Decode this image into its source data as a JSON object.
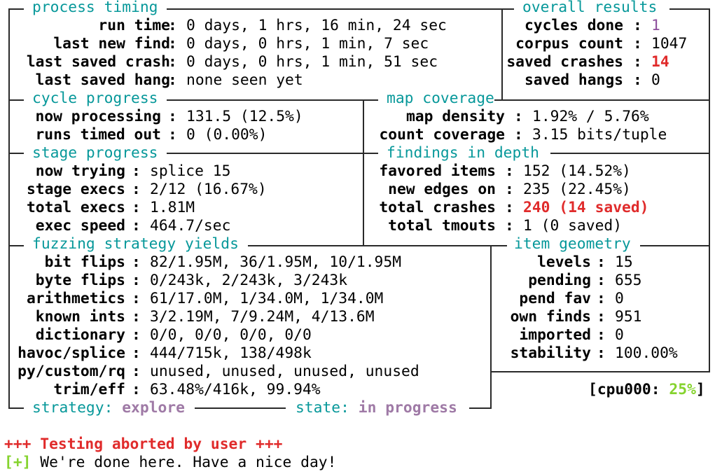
{
  "process_timing": {
    "title": "process timing",
    "run_time_label": "run time",
    "run_time": "0 days, 1 hrs, 16 min, 24 sec",
    "last_new_find_label": "last new find",
    "last_new_find": "0 days, 0 hrs, 1 min, 7 sec",
    "last_saved_crash_label": "last saved crash",
    "last_saved_crash": "0 days, 0 hrs, 1 min, 51 sec",
    "last_saved_hang_label": "last saved hang",
    "last_saved_hang": "none seen yet"
  },
  "overall_results": {
    "title": "overall results",
    "cycles_done_label": "cycles done",
    "cycles_done": "1",
    "corpus_count_label": "corpus count",
    "corpus_count": "1047",
    "saved_crashes_label": "saved crashes",
    "saved_crashes": "14",
    "saved_hangs_label": "saved hangs",
    "saved_hangs": "0"
  },
  "cycle_progress": {
    "title": "cycle progress",
    "now_processing_label": "now processing",
    "now_processing": "131.5 (12.5%)",
    "runs_timed_out_label": "runs timed out",
    "runs_timed_out": "0 (0.00%)"
  },
  "map_coverage": {
    "title": "map coverage",
    "map_density_label": "map density",
    "map_density": "1.92% / 5.76%",
    "count_coverage_label": "count coverage",
    "count_coverage": "3.15 bits/tuple"
  },
  "stage_progress": {
    "title": "stage progress",
    "now_trying_label": "now trying",
    "now_trying": "splice 15",
    "stage_execs_label": "stage execs",
    "stage_execs": "2/12 (16.67%)",
    "total_execs_label": "total execs",
    "total_execs": "1.81M",
    "exec_speed_label": "exec speed",
    "exec_speed": "464.7/sec"
  },
  "findings_in_depth": {
    "title": "findings in depth",
    "favored_items_label": "favored items",
    "favored_items": "152 (14.52%)",
    "new_edges_on_label": "new edges on",
    "new_edges_on": "235 (22.45%)",
    "total_crashes_label": "total crashes",
    "total_crashes": "240 (14 saved)",
    "total_tmouts_label": "total tmouts",
    "total_tmouts": "1 (0 saved)"
  },
  "fuzzing_strategy_yields": {
    "title": "fuzzing strategy yields",
    "bit_flips_label": "bit flips",
    "bit_flips": "82/1.95M, 36/1.95M, 10/1.95M",
    "byte_flips_label": "byte flips",
    "byte_flips": "0/243k, 2/243k, 3/243k",
    "arithmetics_label": "arithmetics",
    "arithmetics": "61/17.0M, 1/34.0M, 1/34.0M",
    "known_ints_label": "known ints",
    "known_ints": "3/2.19M, 7/9.24M, 4/13.6M",
    "dictionary_label": "dictionary",
    "dictionary": "0/0, 0/0, 0/0, 0/0",
    "havoc_splice_label": "havoc/splice",
    "havoc_splice": "444/715k, 138/498k",
    "py_custom_rq_label": "py/custom/rq",
    "py_custom_rq": "unused, unused, unused, unused",
    "trim_eff_label": "trim/eff",
    "trim_eff": "63.48%/416k, 99.94%"
  },
  "item_geometry": {
    "title": "item geometry",
    "levels_label": "levels",
    "levels": "15",
    "pending_label": "pending",
    "pending": "655",
    "pend_fav_label": "pend fav",
    "pend_fav": "0",
    "own_finds_label": "own finds",
    "own_finds": "951",
    "imported_label": "imported",
    "imported": "0",
    "stability_label": "stability",
    "stability": "100.00%"
  },
  "cpu": {
    "label": "cpu000",
    "value": "25%"
  },
  "footer": {
    "strategy_label": "strategy",
    "strategy": "explore",
    "state_label": "state",
    "state": "in progress"
  },
  "messages": {
    "aborted": "+++ Testing aborted by user +++",
    "done_prefix": "[+]",
    "done": "We're done here. Have a nice day!"
  },
  "colors": {
    "title": "#07989a",
    "crash": "#e02b2b",
    "cycles": "#8d4e9b",
    "footer_value": "#9f7aa6",
    "cpu": "#85d32e"
  }
}
